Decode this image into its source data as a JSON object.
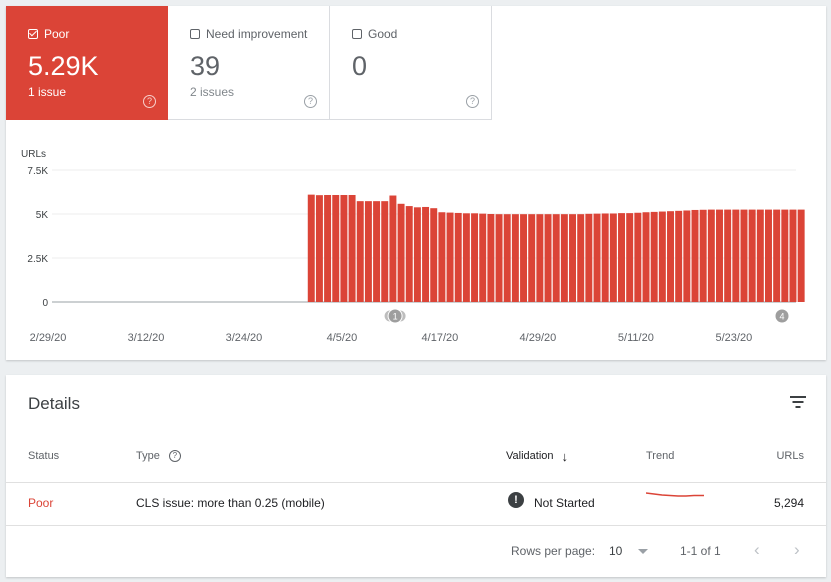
{
  "summary": {
    "poor": {
      "label": "Poor",
      "value": "5.29K",
      "sub": "1 issue",
      "checked": true,
      "color": "#db4437"
    },
    "need_improvement": {
      "label": "Need improvement",
      "value": "39",
      "sub": "2 issues",
      "checked": false
    },
    "good": {
      "label": "Good",
      "value": "0",
      "checked": false
    }
  },
  "chart_data": {
    "type": "bar",
    "ylabel": "URLs",
    "yticks": [
      "7.5K",
      "5K",
      "2.5K",
      "0"
    ],
    "ylim": [
      0,
      7500
    ],
    "xticks": [
      "2/29/20",
      "3/12/20",
      "3/24/20",
      "4/5/20",
      "4/17/20",
      "4/29/20",
      "5/11/20",
      "5/23/20"
    ],
    "x_start": "2/29/20",
    "x_end": "5/30/20",
    "data_start": "4/1/20",
    "color": "#db4437",
    "annotations": [
      "1",
      "4"
    ],
    "values": [
      6100,
      6070,
      6080,
      6080,
      6080,
      6080,
      5730,
      5730,
      5730,
      5730,
      6050,
      5580,
      5450,
      5380,
      5400,
      5330,
      5100,
      5080,
      5060,
      5040,
      5040,
      5020,
      5000,
      4990,
      4990,
      4990,
      4990,
      4990,
      4990,
      4990,
      4990,
      4990,
      4990,
      4990,
      5010,
      5020,
      5030,
      5030,
      5050,
      5050,
      5070,
      5100,
      5120,
      5140,
      5160,
      5180,
      5200,
      5230,
      5240,
      5250,
      5250,
      5250,
      5250,
      5250,
      5250,
      5250,
      5250,
      5250,
      5250,
      5250,
      5250
    ]
  },
  "details": {
    "title": "Details",
    "headers": {
      "status": "Status",
      "type": "Type",
      "validation": "Validation",
      "trend": "Trend",
      "urls": "URLs"
    },
    "row": {
      "status": "Poor",
      "type": "CLS issue: more than 0.25 (mobile)",
      "validation": "Not Started",
      "urls": "5,294"
    },
    "pagination": {
      "rows_label": "Rows per page:",
      "rows_value": "10",
      "range": "1-1 of 1"
    }
  }
}
